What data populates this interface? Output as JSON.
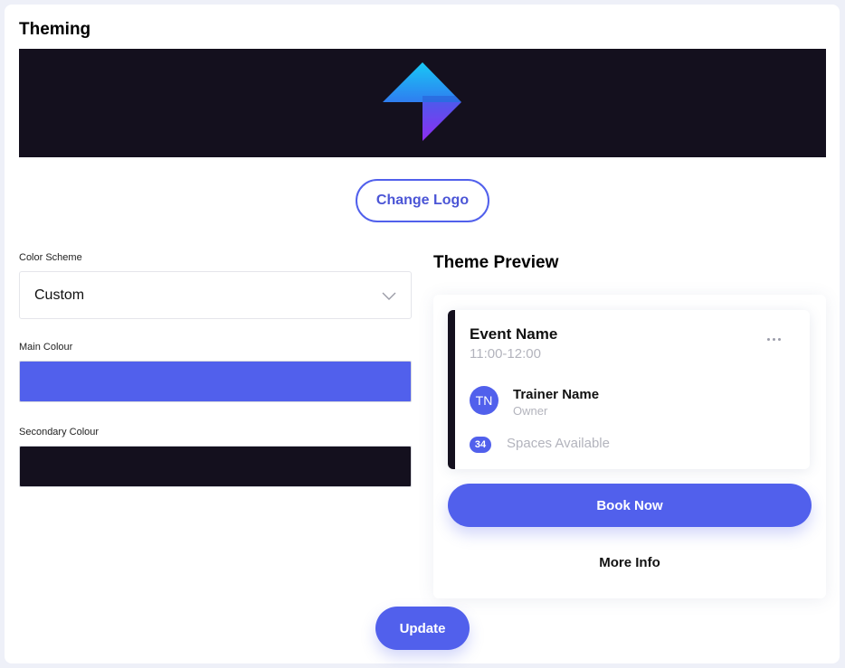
{
  "title": "Theming",
  "colors": {
    "accent": "#5160ec",
    "banner_background": "#14101e",
    "main_colour": "#5160ec",
    "secondary_colour": "#14101e"
  },
  "logo": {
    "icon": "app-logo-icon"
  },
  "change_logo_label": "Change Logo",
  "color_scheme": {
    "label": "Color Scheme",
    "value": "Custom",
    "icon": "chevron-down-icon"
  },
  "main_colour": {
    "label": "Main Colour"
  },
  "secondary_colour": {
    "label": "Secondary Colour"
  },
  "preview": {
    "title": "Theme Preview",
    "event_name": "Event Name",
    "event_time": "11:00-12:00",
    "more_icon": "more-horizontal-icon",
    "trainer_initials": "TN",
    "trainer_name": "Trainer Name",
    "trainer_role": "Owner",
    "spaces_count": "34",
    "spaces_text": "Spaces Available",
    "book_label": "Book Now",
    "more_info_label": "More Info"
  },
  "update_label": "Update"
}
